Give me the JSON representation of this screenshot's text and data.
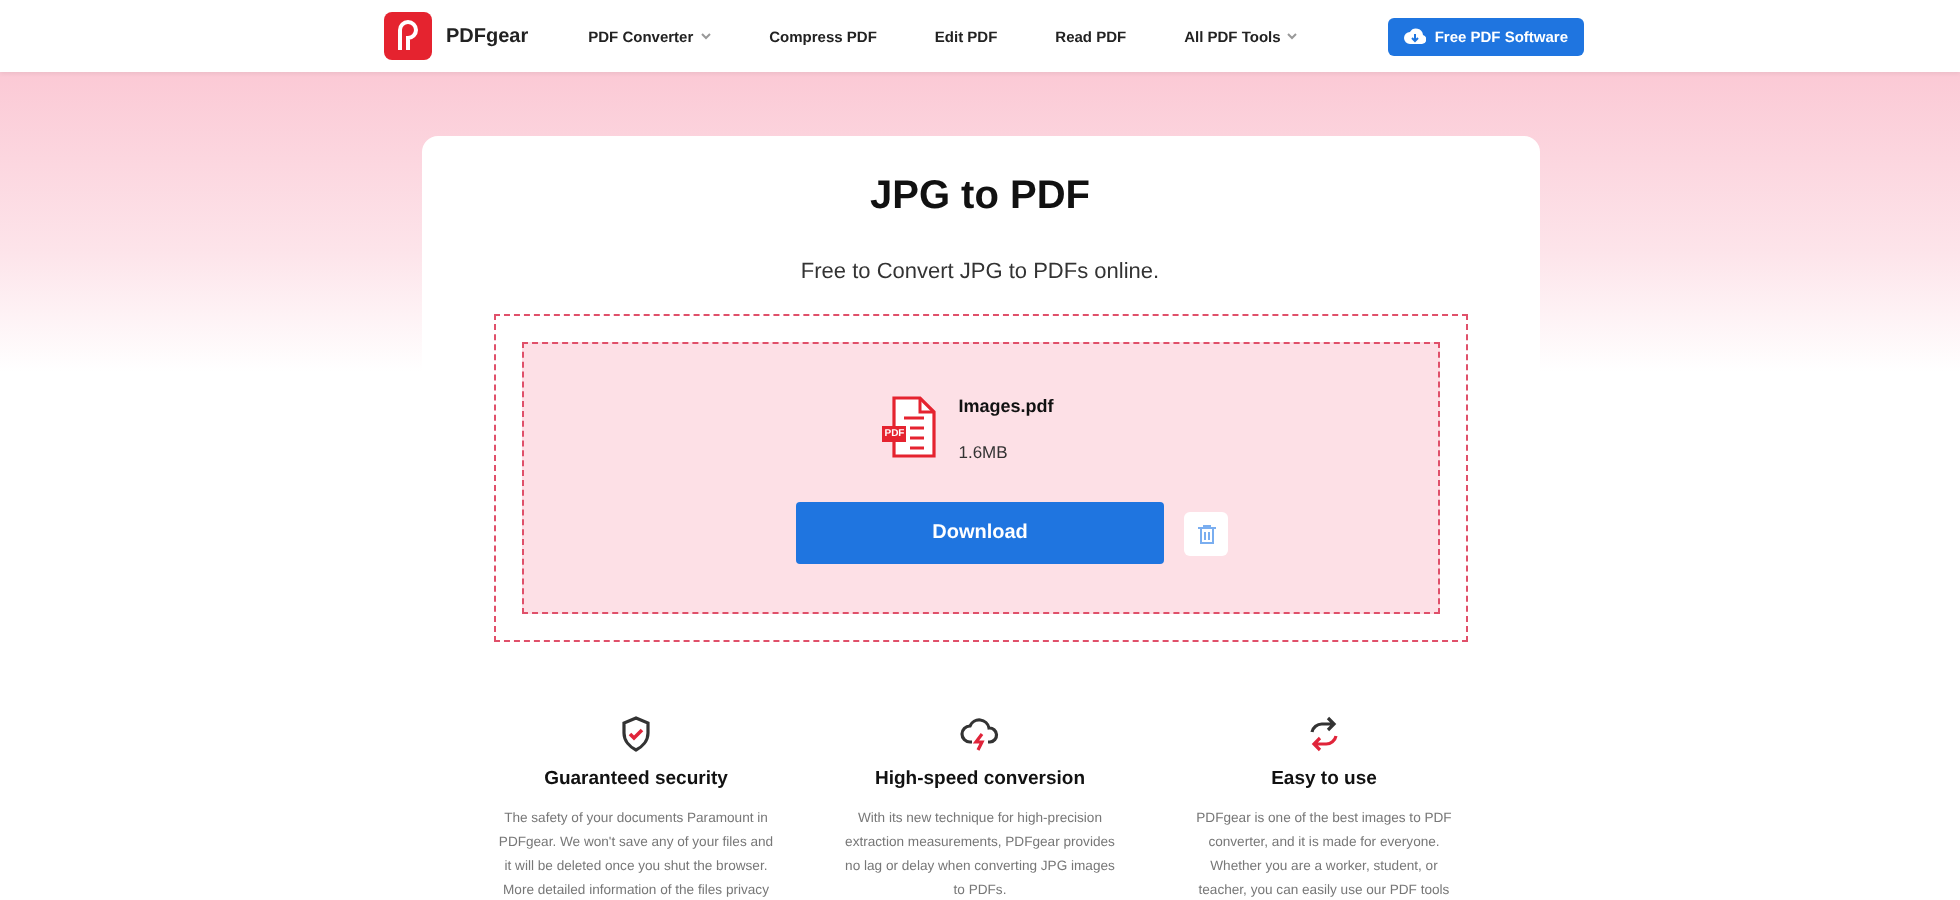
{
  "header": {
    "logo_text": "PDFgear",
    "nav": [
      {
        "label": "PDF Converter",
        "dropdown": true
      },
      {
        "label": "Compress PDF",
        "dropdown": false
      },
      {
        "label": "Edit PDF",
        "dropdown": false
      },
      {
        "label": "Read PDF",
        "dropdown": false
      },
      {
        "label": "All PDF Tools",
        "dropdown": true
      }
    ],
    "cta": "Free PDF Software"
  },
  "converter": {
    "title": "JPG to PDF",
    "subtitle": "Free to Convert JPG to PDFs online.",
    "file": {
      "name": "Images.pdf",
      "size": "1.6MB",
      "badge": "PDF"
    },
    "download": "Download"
  },
  "features": [
    {
      "kind": "shield",
      "title": "Guaranteed security",
      "lines": [
        "The safety of your documents Paramount in",
        "PDFgear. We won't save any of your files and",
        "it will be deleted once you shut the browser.",
        "More detailed information of the files privacy"
      ]
    },
    {
      "kind": "cloud",
      "title": "High-speed conversion",
      "lines": [
        "With its new technique for high-precision",
        "extraction measurements, PDFgear provides",
        "no lag or delay when converting JPG images",
        "to PDFs."
      ]
    },
    {
      "kind": "arrows",
      "title": "Easy to use",
      "lines": [
        "PDFgear is one of the best images to PDF",
        "converter, and it is made for everyone.",
        "Whether you are a worker, student, or",
        "teacher, you can easily use our PDF tools"
      ]
    }
  ]
}
